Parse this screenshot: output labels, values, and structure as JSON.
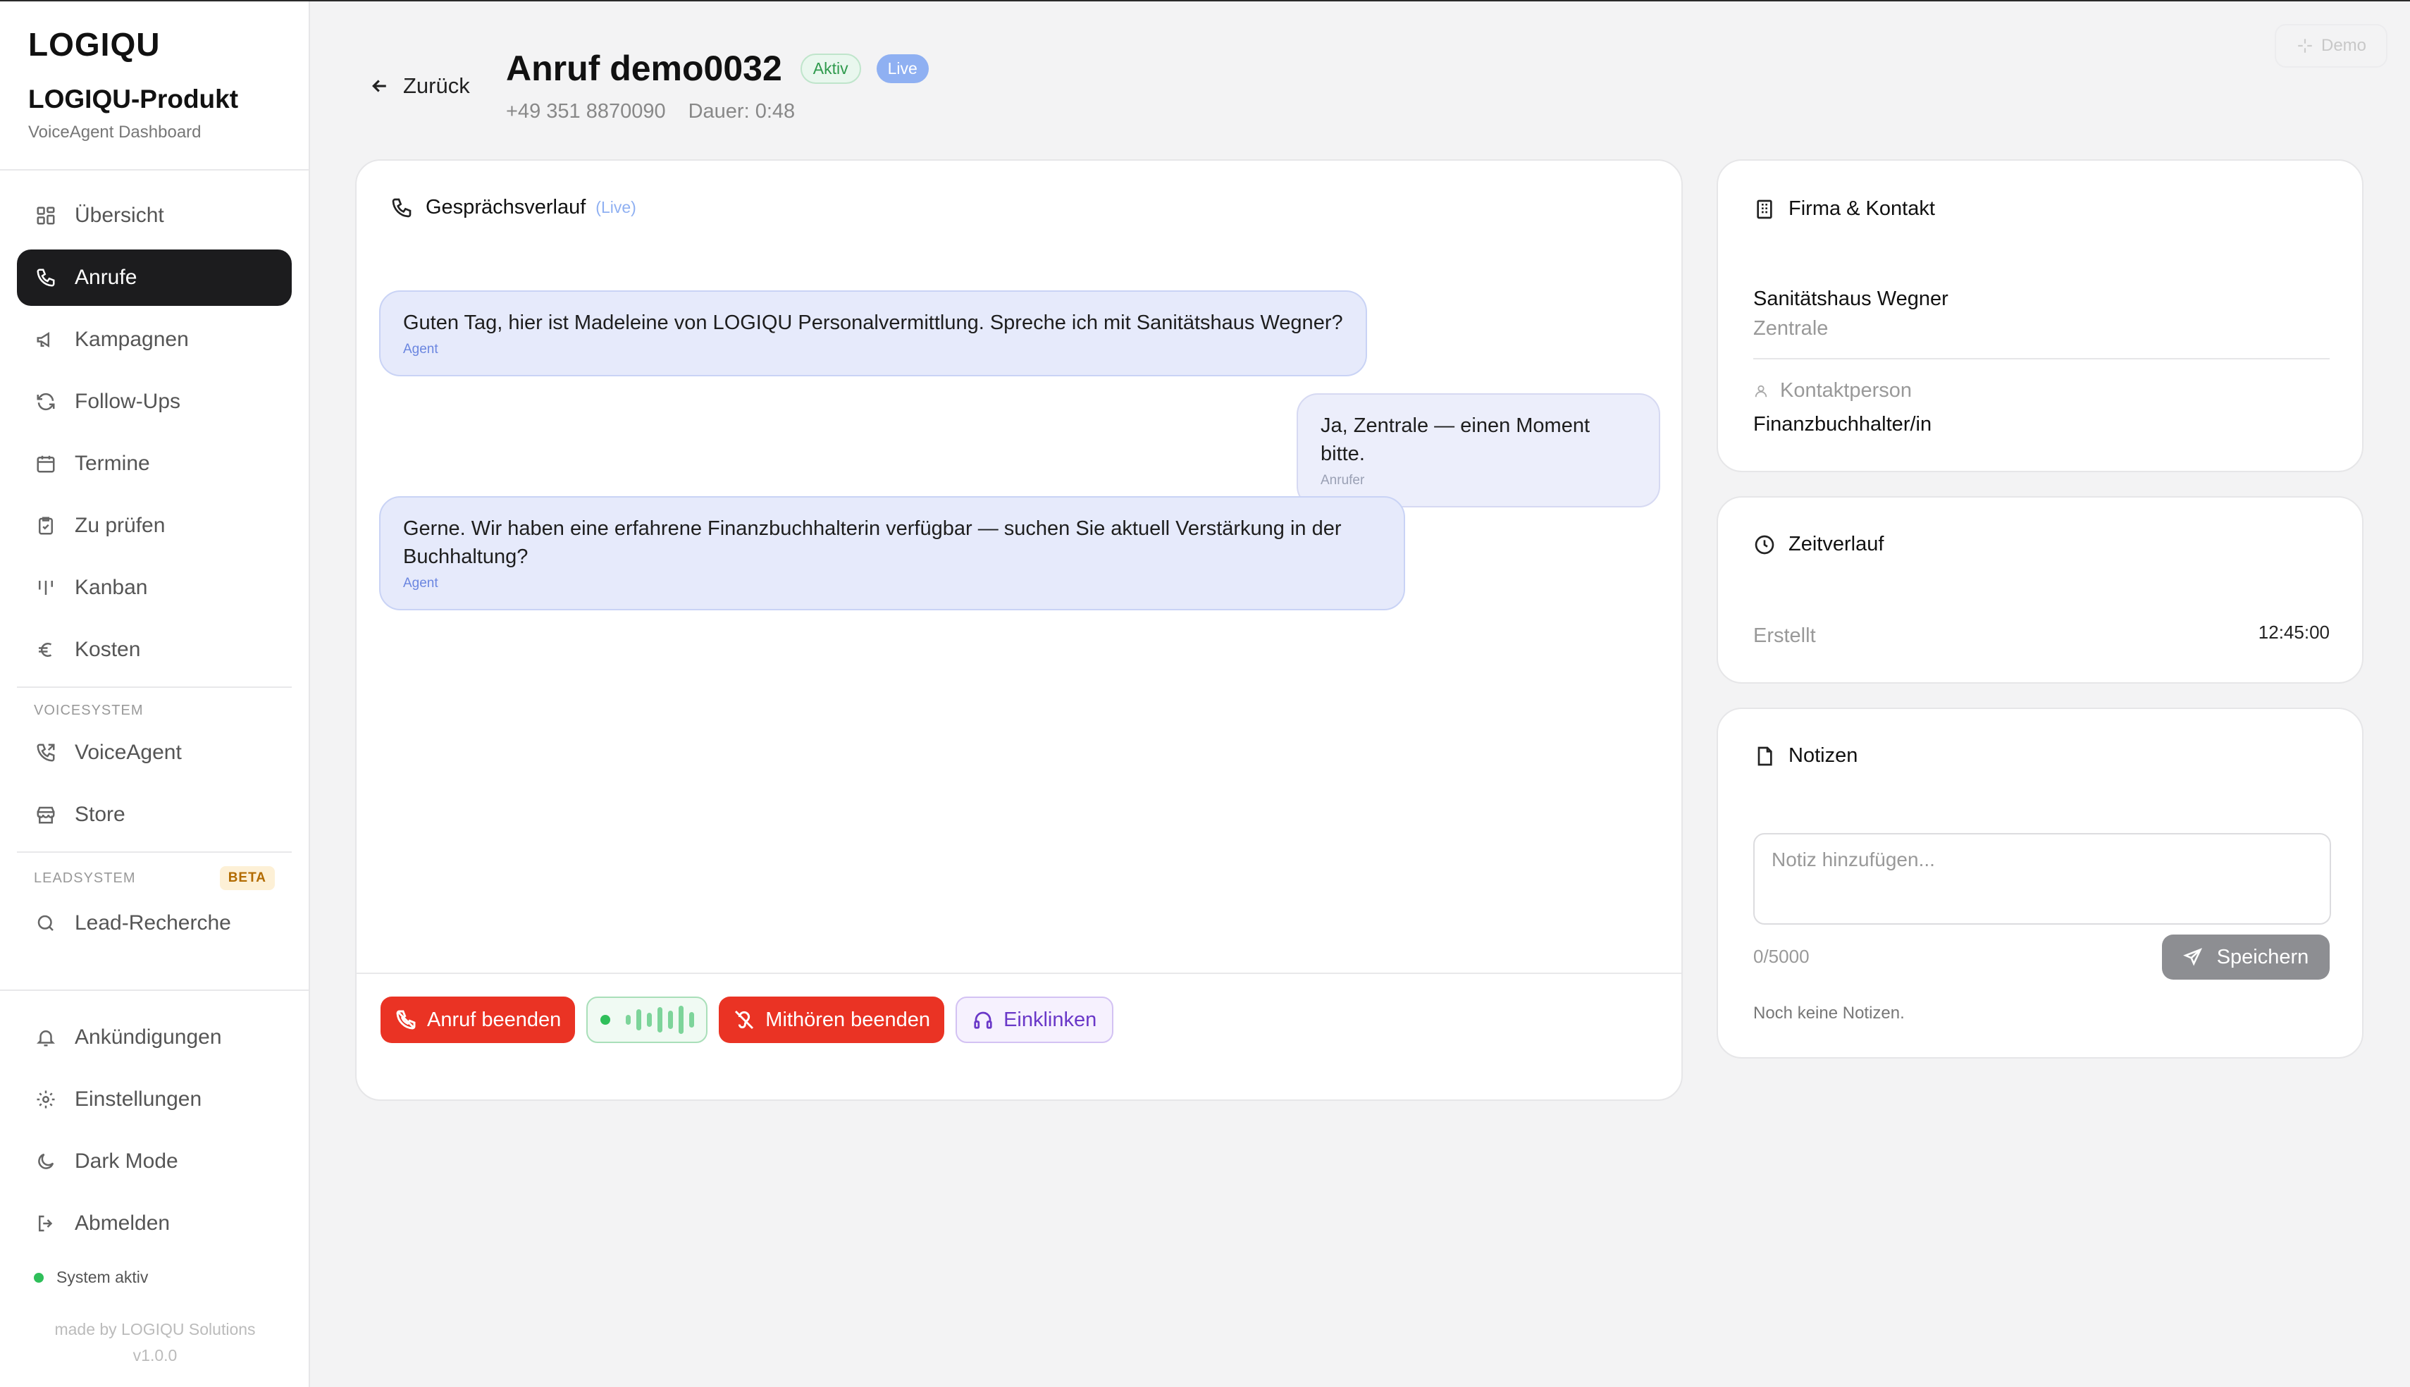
{
  "sidebar": {
    "logo": "LOGIQU",
    "product": "LOGIQU-Produkt",
    "subtitle": "VoiceAgent Dashboard",
    "items": [
      {
        "label": "Übersicht",
        "icon": "grid-icon"
      },
      {
        "label": "Anrufe",
        "icon": "phone-icon",
        "active": true
      },
      {
        "label": "Kampagnen",
        "icon": "megaphone-icon"
      },
      {
        "label": "Follow-Ups",
        "icon": "refresh-icon"
      },
      {
        "label": "Termine",
        "icon": "calendar-icon"
      },
      {
        "label": "Zu prüfen",
        "icon": "clipboard-check-icon"
      },
      {
        "label": "Kanban",
        "icon": "kanban-icon"
      },
      {
        "label": "Kosten",
        "icon": "euro-icon"
      }
    ],
    "voicesystem_label": "VOICESYSTEM",
    "voicesystem_items": [
      {
        "label": "VoiceAgent",
        "icon": "phone-forward-icon"
      },
      {
        "label": "Store",
        "icon": "store-icon"
      }
    ],
    "leadsystem_label": "LEADSYSTEM",
    "leadsystem_badge": "BETA",
    "leadsystem_items": [
      {
        "label": "Lead-Recherche",
        "icon": "search-icon"
      }
    ],
    "bottom_items": [
      {
        "label": "Ankündigungen",
        "icon": "bell-icon"
      },
      {
        "label": "Einstellungen",
        "icon": "gear-icon"
      },
      {
        "label": "Dark Mode",
        "icon": "moon-icon"
      },
      {
        "label": "Abmelden",
        "icon": "logout-icon"
      }
    ],
    "status": "System aktiv",
    "made_by": "made by LOGIQU Solutions",
    "version": "v1.0.0"
  },
  "header": {
    "back_label": "Zurück",
    "title": "Anruf demo0032",
    "badge_status": "Aktiv",
    "badge_live": "Live",
    "phone": "+49 351 8870090",
    "duration": "Dauer: 0:48",
    "demo_label": "Demo"
  },
  "conversation": {
    "title": "Gesprächsverlauf",
    "live_tag": "(Live)",
    "messages": [
      {
        "text": "Guten Tag, hier ist Madeleine von LOGIQU Personalvermittlung. Spreche ich mit Sanitätshaus Wegner?",
        "who": "Agent"
      },
      {
        "text": "Ja, Zentrale — einen Moment bitte.",
        "who": "Anrufer"
      },
      {
        "text": "Gerne. Wir haben eine erfahrene Finanzbuchhalterin verfügbar — suchen Sie aktuell Verstärkung in der Buchhaltung?",
        "who": "Agent"
      }
    ],
    "end_call_label": "Anruf beenden",
    "stop_listen_label": "Mithören beenden",
    "join_label": "Einklinken"
  },
  "company": {
    "title": "Firma & Kontakt",
    "name": "Sanitätshaus Wegner",
    "branch": "Zentrale",
    "contact_label": "Kontaktperson",
    "contact_value": "Finanzbuchhalter/in"
  },
  "timeline": {
    "title": "Zeitverlauf",
    "created_label": "Erstellt",
    "created_value": "12:45:00"
  },
  "notes": {
    "title": "Notizen",
    "placeholder": "Notiz hinzufügen...",
    "counter": "0/5000",
    "save_label": "Speichern",
    "empty": "Noch keine Notizen."
  }
}
